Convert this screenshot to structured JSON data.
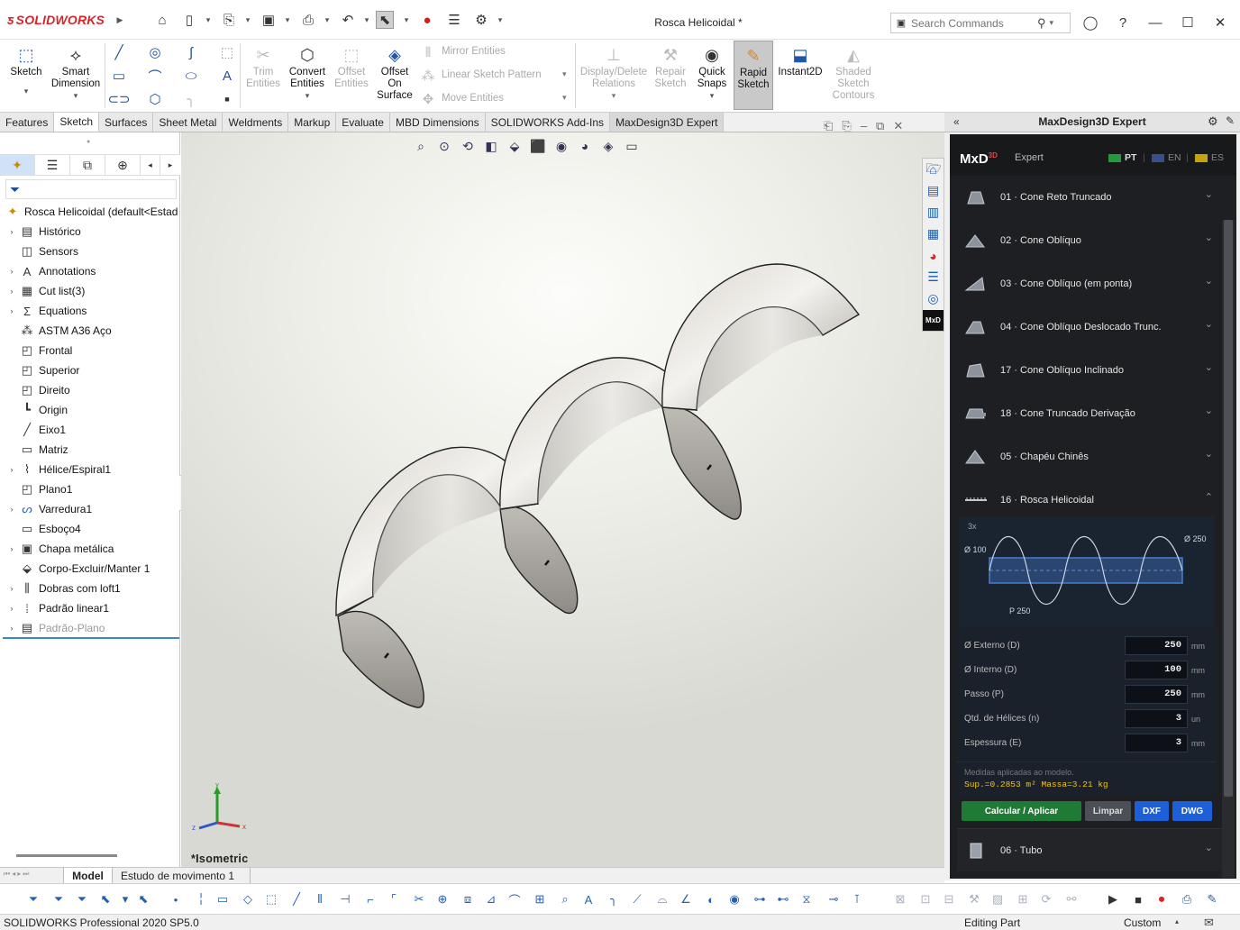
{
  "app": {
    "brand": "SOLIDWORKS",
    "doc_title": "Rosca Helicoidal *"
  },
  "search": {
    "placeholder": "Search Commands"
  },
  "commands": {
    "sketch": "Sketch",
    "smart_dimension_1": "Smart",
    "smart_dimension_2": "Dimension",
    "trim_1": "Trim",
    "trim_2": "Entities",
    "convert_1": "Convert",
    "convert_2": "Entities",
    "offset_1": "Offset",
    "offset_2": "Entities",
    "offset_surface_1": "Offset",
    "offset_surface_2": "On",
    "offset_surface_3": "Surface",
    "mirror": "Mirror Entities",
    "linear_pattern": "Linear Sketch Pattern",
    "move": "Move Entities",
    "display_delete_1": "Display/Delete",
    "display_delete_2": "Relations",
    "repair_1": "Repair",
    "repair_2": "Sketch",
    "quick_snaps_1": "Quick",
    "quick_snaps_2": "Snaps",
    "rapid_1": "Rapid",
    "rapid_2": "Sketch",
    "instant2d": "Instant2D",
    "shaded_1": "Shaded",
    "shaded_2": "Sketch",
    "shaded_3": "Contours"
  },
  "tabs": [
    "Features",
    "Sketch",
    "Surfaces",
    "Sheet Metal",
    "Weldments",
    "Markup",
    "Evaluate",
    "MBD Dimensions",
    "SOLIDWORKS Add-Ins",
    "MaxDesign3D Expert"
  ],
  "active_tab": "Sketch",
  "tree": {
    "root": "Rosca Helicoidal  (default<Estad",
    "items": [
      {
        "label": "Histórico",
        "icon": "history-folder-icon",
        "exp": true
      },
      {
        "label": "Sensors",
        "icon": "sensors-icon",
        "exp": false
      },
      {
        "label": "Annotations",
        "icon": "annotations-icon",
        "exp": true
      },
      {
        "label": "Cut list(3)",
        "icon": "cut-list-icon",
        "exp": true
      },
      {
        "label": "Equations",
        "icon": "equations-icon",
        "exp": true
      },
      {
        "label": "ASTM A36 Aço",
        "icon": "material-icon",
        "exp": false
      },
      {
        "label": "Frontal",
        "icon": "plane-icon",
        "exp": false
      },
      {
        "label": "Superior",
        "icon": "plane-icon",
        "exp": false
      },
      {
        "label": "Direito",
        "icon": "plane-icon",
        "exp": false
      },
      {
        "label": "Origin",
        "icon": "origin-icon",
        "exp": false
      },
      {
        "label": "Eixo1",
        "icon": "axis-icon",
        "exp": false
      },
      {
        "label": "Matriz",
        "icon": "sketch-icon",
        "exp": false
      },
      {
        "label": "Hélice/Espiral1",
        "icon": "helix-icon",
        "exp": true
      },
      {
        "label": "Plano1",
        "icon": "plane-icon",
        "exp": false
      },
      {
        "label": "Varredura1",
        "icon": "sweep-icon",
        "exp": true
      },
      {
        "label": "Esboço4",
        "icon": "sketch-icon",
        "exp": false
      },
      {
        "label": "Chapa metálica",
        "icon": "sheet-metal-icon",
        "exp": true
      },
      {
        "label": "Corpo-Excluir/Manter 1",
        "icon": "body-delete-icon",
        "exp": false
      },
      {
        "label": "Dobras com loft1",
        "icon": "lofted-bend-icon",
        "exp": true
      },
      {
        "label": "Padrão linear1",
        "icon": "linear-pattern-icon",
        "exp": true
      },
      {
        "label": "Padrão-Plano",
        "icon": "flat-pattern-icon",
        "exp": true
      }
    ]
  },
  "viewport": {
    "view_label": "*Isometric"
  },
  "panel": {
    "title": "MaxDesign3D Expert",
    "brand": "MxD",
    "brand_sup": "3D",
    "brand_sub": "Expert",
    "langs": [
      "PT",
      "EN",
      "ES"
    ],
    "items": [
      "01 · Cone Reto Truncado",
      "02 · Cone Oblíquo",
      "03 · Cone Oblíquo (em ponta)",
      "04 · Cone Oblíquo Deslocado Trunc.",
      "17 · Cone Oblíquo Inclinado",
      "18 · Cone Truncado Derivação",
      "05 · Chapéu Chinês",
      "16 · Rosca Helicoidal"
    ],
    "diagram": {
      "count": "3x",
      "inner": "Ø 100",
      "outer": "Ø 250",
      "pitch": "P 250"
    },
    "fields": [
      {
        "label": "Ø Externo (D)",
        "value": "250",
        "unit": "mm"
      },
      {
        "label": "Ø Interno (D)",
        "value": "100",
        "unit": "mm"
      },
      {
        "label": "Passo (P)",
        "value": "250",
        "unit": "mm"
      },
      {
        "label": "Qtd. de Hélices (n)",
        "value": "3",
        "unit": "un"
      },
      {
        "label": "Espessura (E)",
        "value": "3",
        "unit": "mm"
      }
    ],
    "note": "Medidas aplicadas ao modelo.",
    "result": "Sup.=0.2853 m²   Massa=3.21 kg",
    "buttons": {
      "calc": "Calcular / Aplicar",
      "clear": "Limpar",
      "dxf": "DXF",
      "dwg": "DWG"
    },
    "next_item": "06 · Tubo",
    "colors": {
      "bg": "#1e1f22",
      "accent_green": "#1e7a35",
      "accent_blue": "#1d5fd6",
      "result_yellow": "#f0c419"
    }
  },
  "bottom_tabs": {
    "model": "Model",
    "motion": "Estudo de movimento 1"
  },
  "status": {
    "left": "SOLIDWORKS Professional 2020 SP5.0",
    "mode": "Editing Part",
    "units": "Custom"
  }
}
